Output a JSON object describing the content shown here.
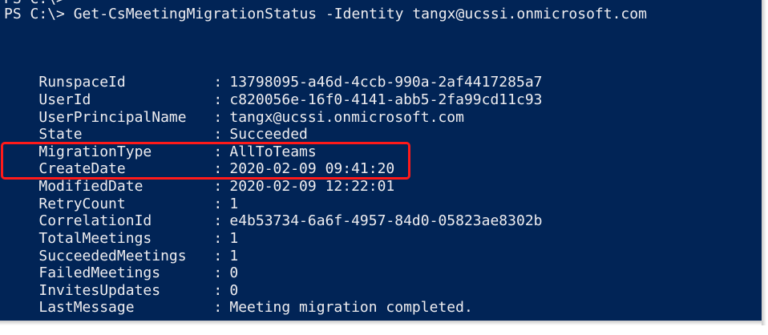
{
  "console": {
    "background": "#012456",
    "foreground": "#eeedf0",
    "cut_line": "PS C:\\>",
    "command_line": "PS C:\\> Get-CsMeetingMigrationStatus -Identity tangx@ucssi.onmicrosoft.com"
  },
  "output": [
    {
      "key": "RunspaceId",
      "value": "13798095-a46d-4ccb-990a-2af4417285a7"
    },
    {
      "key": "UserId",
      "value": "c820056e-16f0-4141-abb5-2fa99cd11c93"
    },
    {
      "key": "UserPrincipalName",
      "value": "tangx@ucssi.onmicrosoft.com"
    },
    {
      "key": "State",
      "value": "Succeeded"
    },
    {
      "key": "MigrationType",
      "value": "AllToTeams"
    },
    {
      "key": "CreateDate",
      "value": "2020-02-09 09:41:20"
    },
    {
      "key": "ModifiedDate",
      "value": "2020-02-09 12:22:01"
    },
    {
      "key": "RetryCount",
      "value": "1"
    },
    {
      "key": "CorrelationId",
      "value": "e4b53734-6a6f-4957-84d0-05823ae8302b"
    },
    {
      "key": "TotalMeetings",
      "value": "1"
    },
    {
      "key": "SucceededMeetings",
      "value": "1"
    },
    {
      "key": "FailedMeetings",
      "value": "0"
    },
    {
      "key": "InvitesUpdates",
      "value": "0"
    },
    {
      "key": "LastMessage",
      "value": "Meeting migration completed."
    }
  ],
  "separator": ":",
  "highlight_color": "#ff1a1a"
}
